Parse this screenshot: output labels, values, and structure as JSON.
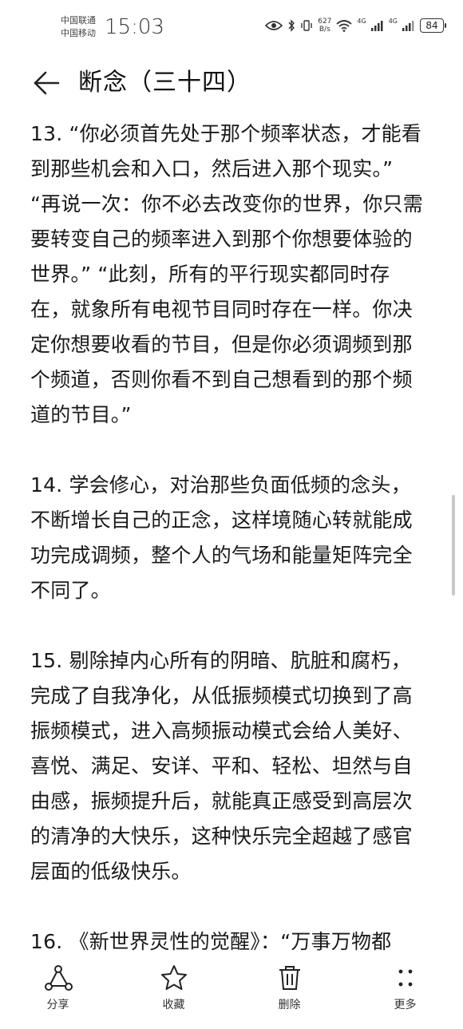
{
  "status_bar": {
    "carrier_1": "中国联通",
    "carrier_2": "中国移动",
    "time": "15:03",
    "speed_value": "627",
    "speed_unit": "B/s",
    "network_1": "4G",
    "network_2": "4G",
    "battery": "84",
    "icons": [
      "eye-icon",
      "bluetooth-icon",
      "vibrate-icon",
      "wifi-icon",
      "signal-icon",
      "signal-icon",
      "battery-icon"
    ]
  },
  "header": {
    "back_icon": "back-arrow-icon",
    "title": "断念（三十四）"
  },
  "article": {
    "paragraphs": [
      "13. “你必须首先处于那个频率状态，才能看到那些机会和入口，然后进入那个现实。” “再说一次：你不必去改变你的世界，你只需要转变自己的频率进入到那个你想要体验的世界。” “此刻，所有的平行现实都同时存在，就象所有电视节目同时存在一样。你决定你想要收看的节目，但是你必须调频到那个频道，否则你看不到自己想看到的那个频道的节目。”",
      "14. 学会修心，对治那些负面低频的念头，不断增长自己的正念，这样境随心转就能成功完成调频，整个人的气场和能量矩阵完全不同了。",
      "15. 剔除掉内心所有的阴暗、肮脏和腐朽，完成了自我净化，从低振频模式切换到了高振频模式，进入高频振动模式会给人美好、喜悦、满足、安详、平和、轻松、坦然与自由感，振频提升后，就能真正感受到高层次的清净的大快乐，这种快乐完全超越了感官层面的低级快乐。",
      "16. 《新世界灵性的觉醒》：“万事万物都"
    ]
  },
  "toolbar": {
    "share_label": "分享",
    "favorite_label": "收藏",
    "delete_label": "删除",
    "more_label": "更多"
  }
}
